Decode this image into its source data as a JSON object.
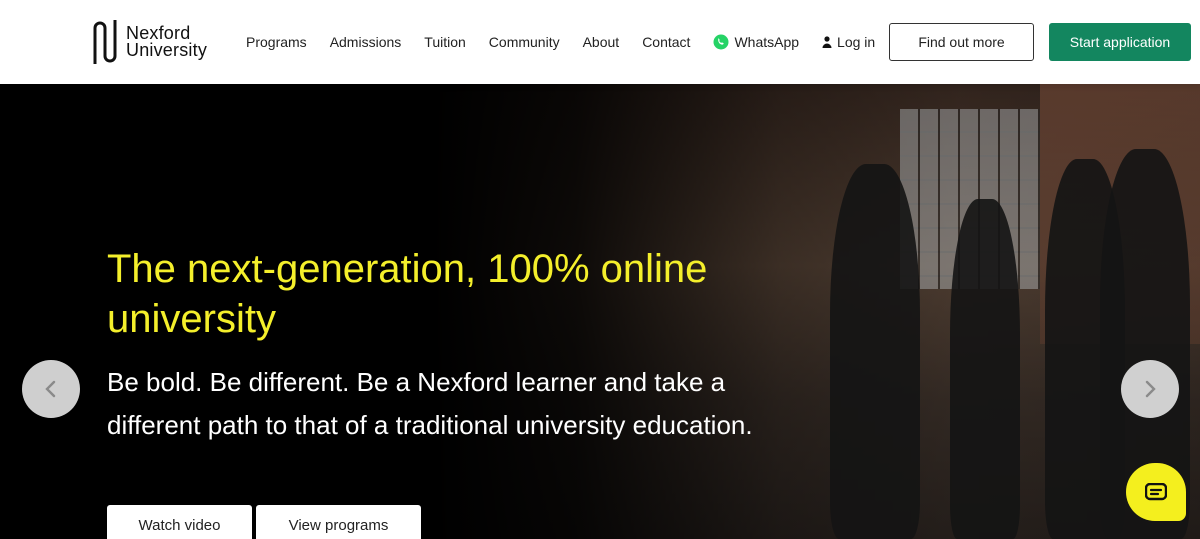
{
  "brand": {
    "line1": "Nexford",
    "line2": "University"
  },
  "nav": {
    "items": [
      "Programs",
      "Admissions",
      "Tuition",
      "Community",
      "About",
      "Contact"
    ],
    "whatsapp": "WhatsApp",
    "login": "Log in"
  },
  "header_buttons": {
    "find_out_more": "Find out more",
    "start_application": "Start application"
  },
  "hero": {
    "title": "The next-generation, 100% online university",
    "subtitle": "Be bold. Be different. Be a Nexford learner and take a different path to that of a traditional university education.",
    "watch_video": "Watch video",
    "view_programs": "View programs"
  },
  "colors": {
    "accent_yellow": "#f4ef2b",
    "brand_green": "#13865f",
    "whatsapp_green": "#25d366"
  },
  "icons": [
    "nexford-logo-icon",
    "whatsapp-icon",
    "user-icon",
    "chevron-left-icon",
    "chevron-right-icon",
    "chat-icon"
  ]
}
